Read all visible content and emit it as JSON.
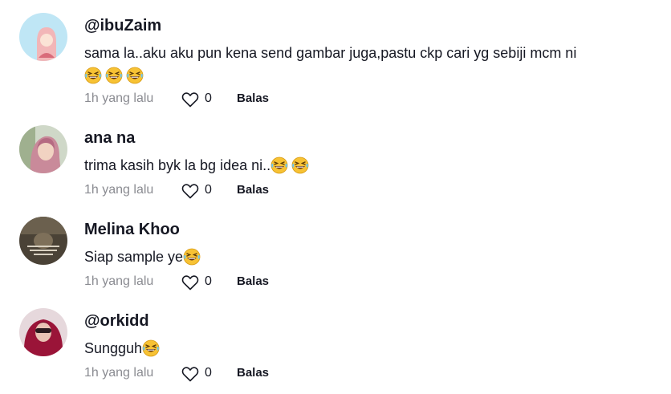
{
  "comments": [
    {
      "username": "@ibuZaim",
      "text": "sama la..aku aku pun kena send gambar juga,pastu ckp cari yg sebiji mcm ni",
      "emoji_count": 3,
      "emoji_icon": "laughing-face-icon",
      "time": "1h yang lalu",
      "likes": "0",
      "reply": "Balas"
    },
    {
      "username": "ana na",
      "text": "trima kasih byk la bg idea ni..",
      "emoji_count": 2,
      "emoji_icon": "laughing-face-icon",
      "time": "1h yang lalu",
      "likes": "0",
      "reply": "Balas"
    },
    {
      "username": "Melina Khoo",
      "text": "Siap sample ye",
      "emoji_count": 1,
      "emoji_icon": "laughing-face-icon",
      "time": "1h yang lalu",
      "likes": "0",
      "reply": "Balas"
    },
    {
      "username": "@orkidd",
      "text": "Sungguh",
      "emoji_count": 1,
      "emoji_icon": "laughing-face-icon",
      "time": "1h yang lalu",
      "likes": "0",
      "reply": "Balas"
    }
  ],
  "colors": {
    "text": "#161823",
    "muted": "#8a8b91",
    "emoji": "#f7c234"
  }
}
